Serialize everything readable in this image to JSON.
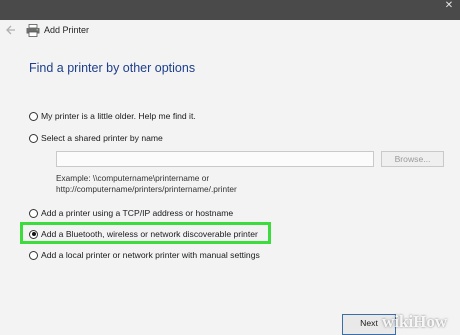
{
  "window": {
    "title": "Add Printer",
    "close_glyph": "✕"
  },
  "icons": {
    "back": "back-arrow-icon",
    "printer": "printer-icon"
  },
  "main": {
    "heading": "Find a printer by other options",
    "options": [
      {
        "label": "My printer is a little older. Help me find it.",
        "selected": false
      },
      {
        "label": "Select a shared printer by name",
        "selected": false
      },
      {
        "label": "Add a printer using a TCP/IP address or hostname",
        "selected": false
      },
      {
        "label": "Add a Bluetooth, wireless or network discoverable printer",
        "selected": true
      },
      {
        "label": "Add a local printer or network printer with manual settings",
        "selected": false
      }
    ],
    "shared_printer": {
      "value": "",
      "browse_label": "Browse...",
      "example_line1": "Example: \\\\computername\\printername or",
      "example_line2": "http://computername/printers/printername/.printer"
    }
  },
  "footer": {
    "next_label": "Next"
  },
  "watermark": {
    "text": "wikiHow"
  },
  "colors": {
    "heading": "#1e3f8b",
    "highlight": "#3cdc3c",
    "dialog_bg": "#f3f3f3",
    "backdrop": "#4a4a4a"
  }
}
